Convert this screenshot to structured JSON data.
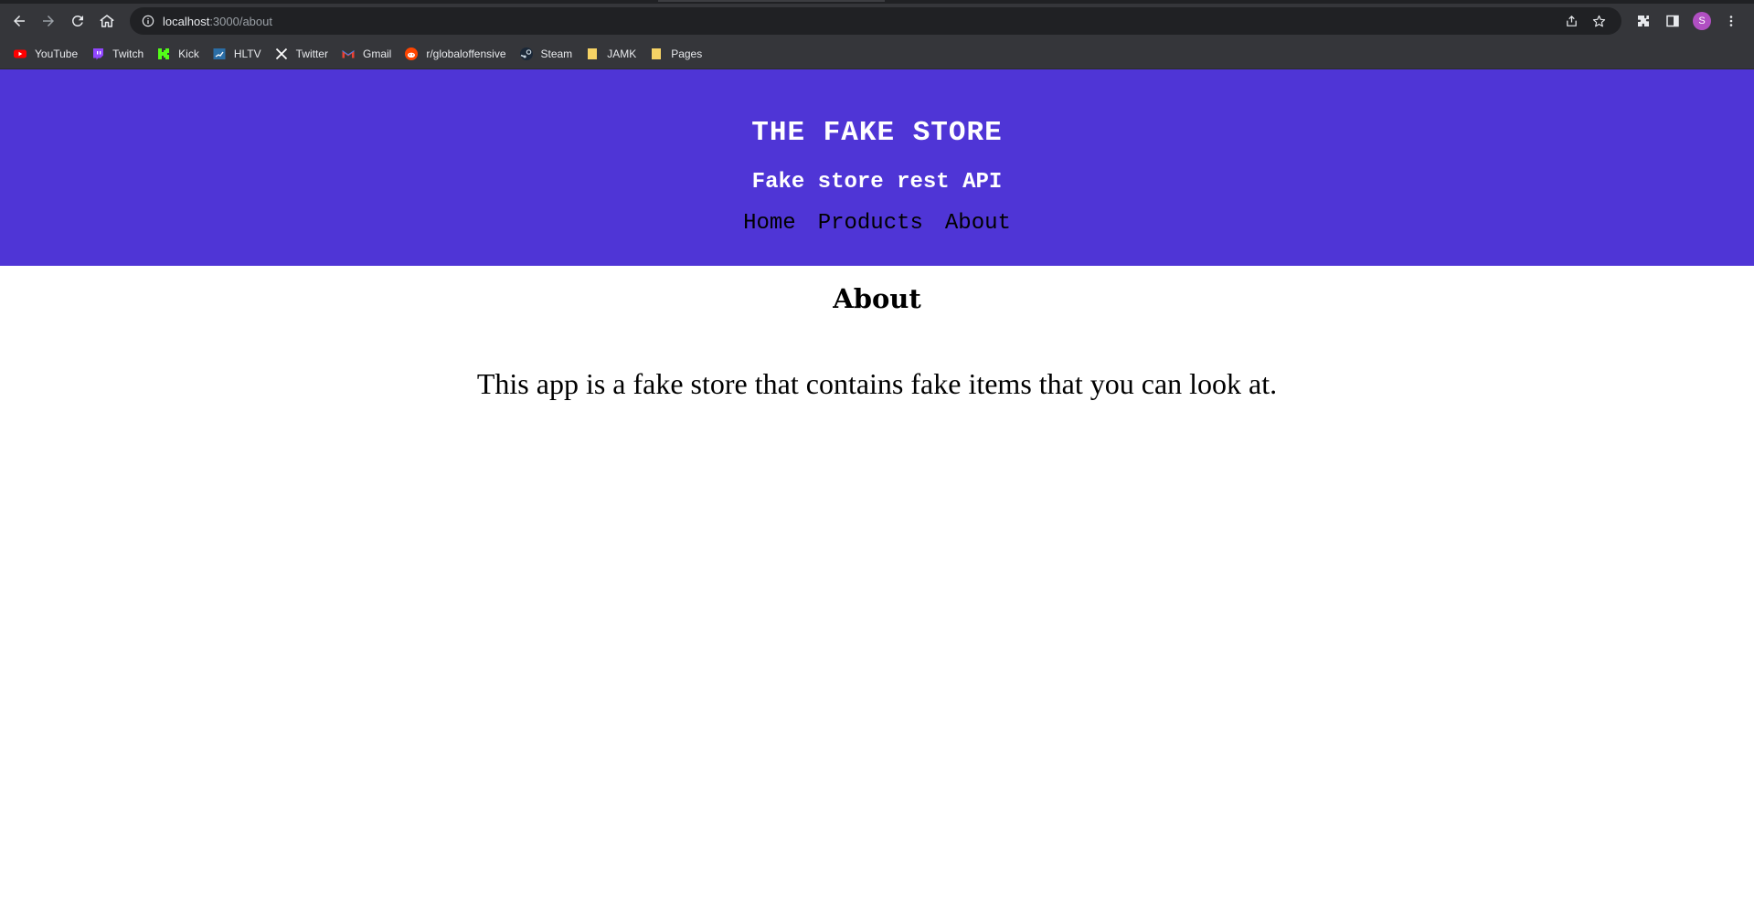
{
  "browser": {
    "url_host": "localhost",
    "url_path": ":3000/about",
    "avatar_letter": "S",
    "bookmarks": [
      {
        "label": "YouTube",
        "icon": "youtube-icon",
        "color": "#ff0000"
      },
      {
        "label": "Twitch",
        "icon": "twitch-icon",
        "color": "#9146ff"
      },
      {
        "label": "Kick",
        "icon": "kick-icon",
        "color": "#53fc18"
      },
      {
        "label": "HLTV",
        "icon": "hltv-icon",
        "color": "#2b6ea6"
      },
      {
        "label": "Twitter",
        "icon": "x-icon",
        "color": "#ffffff"
      },
      {
        "label": "Gmail",
        "icon": "gmail-icon",
        "color": "#ea4335"
      },
      {
        "label": "r/globaloffensive",
        "icon": "reddit-icon",
        "color": "#ff4500"
      },
      {
        "label": "Steam",
        "icon": "steam-icon",
        "color": "#c7d5e0"
      },
      {
        "label": "JAMK",
        "icon": "folder-icon",
        "color": "#f6d365"
      },
      {
        "label": "Pages",
        "icon": "folder-icon",
        "color": "#f6d365"
      }
    ]
  },
  "site": {
    "title": "THE FAKE STORE",
    "subtitle": "Fake store rest API",
    "nav": [
      "Home",
      "Products",
      "About"
    ],
    "header_color": "#4f35d6"
  },
  "page": {
    "heading": "About",
    "body": "This app is a fake store that contains fake items that you can look at."
  }
}
